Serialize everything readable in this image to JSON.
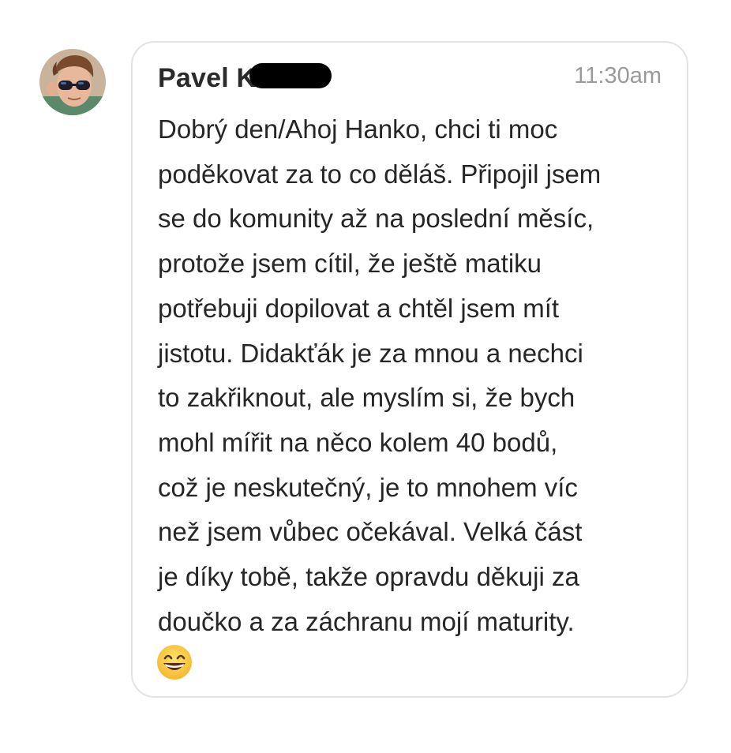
{
  "message": {
    "author": "Pavel K",
    "timestamp": "11:30am",
    "lines": [
      "Dobrý den/Ahoj Hanko, chci ti moc",
      "poděkovat za to co děláš. Připojil jsem",
      "se do komunity až na poslední měsíc,",
      "protože jsem cítil, že ještě matiku",
      "potřebuji dopilovat a chtěl jsem mít",
      "jistotu. Didakťák je za mnou a nechci",
      "to zakřiknout, ale myslím si, že bych",
      "mohl mířit na něco kolem 40 bodů,",
      "což je neskutečný, je to mnohem víc",
      "než jsem vůbec očekával. Velká část",
      "je díky tobě, takže opravdu děkuji za",
      "doučko a za záchranu mojí maturity."
    ],
    "emoji": "grinning-face-with-smiling-eyes"
  },
  "colors": {
    "bubble_border": "#e3e3e3",
    "timestamp": "#9a9a9a",
    "text": "#262626",
    "redaction": "#000000"
  }
}
